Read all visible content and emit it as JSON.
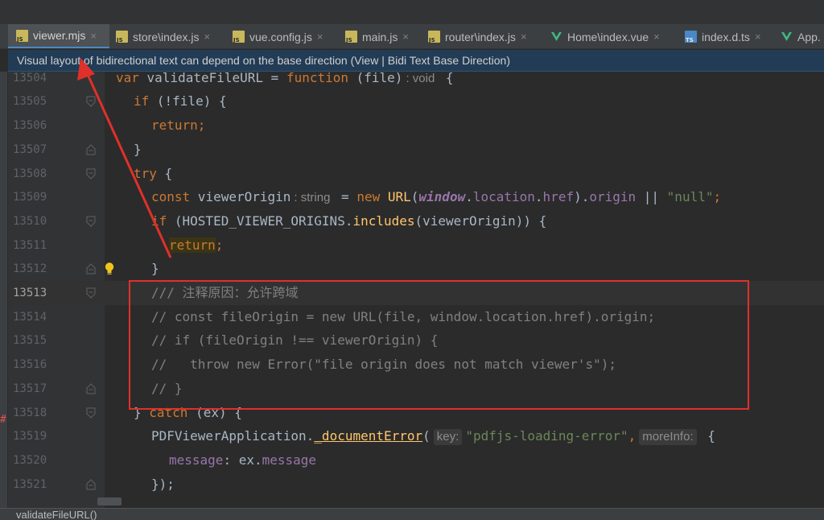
{
  "tabs": [
    {
      "label": "viewer.mjs",
      "icon": "js-file-icon",
      "active": true,
      "closable": true
    },
    {
      "label": "store\\index.js",
      "icon": "js-file-icon",
      "active": false,
      "closable": true
    },
    {
      "label": "vue.config.js",
      "icon": "js-file-icon",
      "active": false,
      "closable": true
    },
    {
      "label": "main.js",
      "icon": "js-file-icon",
      "active": false,
      "closable": true
    },
    {
      "label": "router\\index.js",
      "icon": "js-file-icon",
      "active": false,
      "closable": true
    },
    {
      "label": "Home\\index.vue",
      "icon": "vue-file-icon",
      "active": false,
      "closable": true
    },
    {
      "label": "index.d.ts",
      "icon": "ts-file-icon",
      "active": false,
      "closable": true
    },
    {
      "label": "App.",
      "icon": "vue-file-icon",
      "active": false,
      "closable": false
    }
  ],
  "close_glyph": "×",
  "banner": {
    "text": "Visual layout of bidirectional text can depend on the base direction (View | Bidi Text Base Direction)"
  },
  "lines": [
    {
      "num": "13504"
    },
    {
      "num": "13505"
    },
    {
      "num": "13506"
    },
    {
      "num": "13507"
    },
    {
      "num": "13508"
    },
    {
      "num": "13509"
    },
    {
      "num": "13510"
    },
    {
      "num": "13511"
    },
    {
      "num": "13512"
    },
    {
      "num": "13513"
    },
    {
      "num": "13514"
    },
    {
      "num": "13515"
    },
    {
      "num": "13516"
    },
    {
      "num": "13517"
    },
    {
      "num": "13518"
    },
    {
      "num": "13519"
    },
    {
      "num": "13520"
    },
    {
      "num": "13521"
    }
  ],
  "code": {
    "l13504": {
      "kw1": "var",
      "name": " validateFileURL ",
      "eq": "= ",
      "kw2": "function",
      "args": " (file)",
      "hint": ": void",
      "tail": " {"
    },
    "l13505": {
      "kw": "if",
      "rest": " (!file) {"
    },
    "l13506": {
      "kw": "return",
      "semi": ";"
    },
    "l13507": {
      "text": "}"
    },
    "l13508": {
      "kw": "try",
      "rest": " {"
    },
    "l13509": {
      "kw": "const",
      "name": " viewerOrigin",
      "hint": ": string",
      "eq": " = ",
      "kw2": "new",
      "cls": " URL",
      "p1": "(",
      "glob": "window",
      "dot1": ".",
      "prop1": "location",
      "dot2": ".",
      "prop2": "href",
      "p2": ").",
      "prop3": "origin",
      "op": " || ",
      "str": "\"null\"",
      "semi": ";"
    },
    "l13510": {
      "kw": "if",
      "p1": " (HOSTED_VIEWER_ORIGINS.",
      "fn": "includes",
      "p2": "(viewerOrigin)) {"
    },
    "l13511": {
      "kw": "return",
      "semi": ";"
    },
    "l13512": {
      "text": "}"
    },
    "l13513": {
      "text": "/// 注释原因：允许跨域"
    },
    "l13514": {
      "text": "// const fileOrigin = new URL(file, window.location.href).origin;"
    },
    "l13515": {
      "text": "// if (fileOrigin !== viewerOrigin) {"
    },
    "l13516": {
      "text": "//   throw new Error(\"file origin does not match viewer's\");"
    },
    "l13517": {
      "text": "// }"
    },
    "l13518": {
      "p1": "} ",
      "kw": "catch",
      "p2": " (ex) {"
    },
    "l13519": {
      "p1": "PDFViewerApplication.",
      "fn": "_documentError",
      "p2": "(",
      "hint1": "key:",
      "str": "\"pdfjs-loading-error\"",
      "comma": ",",
      "hint2": "moreInfo:",
      "p3": " {"
    },
    "l13520": {
      "prop": "message",
      "p1": ": ex.",
      "prop2": "message"
    },
    "l13521": {
      "text": "});"
    }
  },
  "statusbar": {
    "text": "validateFileURL()"
  },
  "colors": {
    "annotation": "#e0302a",
    "accent": "#4a88c7"
  }
}
